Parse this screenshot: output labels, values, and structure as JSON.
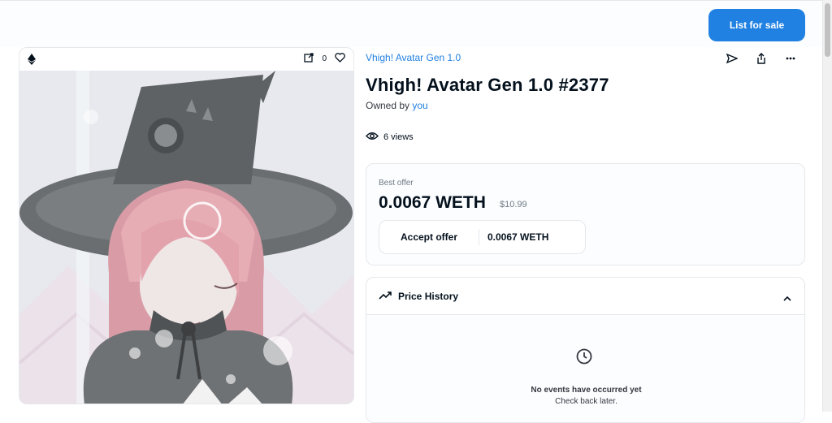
{
  "header": {
    "list_for_sale_label": "List for sale"
  },
  "media": {
    "like_count": "0",
    "icons": [
      "ethereum-icon",
      "external-link-icon",
      "heart-icon"
    ],
    "image_alt": "Anime girl with pink hair wearing a witch hat"
  },
  "item": {
    "collection_name": "Vhigh! Avatar Gen 1.0",
    "title": "Vhigh! Avatar Gen 1.0 #2377",
    "owned_by_prefix": "Owned by",
    "owner": "you",
    "views": "6 views"
  },
  "offer": {
    "label": "Best offer",
    "price": "0.0067 WETH",
    "usd": "$10.99",
    "accept_label": "Accept offer",
    "accept_value": "0.0067 WETH"
  },
  "price_history": {
    "title": "Price History",
    "empty_title": "No events have occurred yet",
    "empty_subtitle": "Check back later."
  },
  "colors": {
    "accent": "#2081e2",
    "text": "#04111d",
    "muted": "#707a83",
    "border": "#e5e8eb"
  }
}
